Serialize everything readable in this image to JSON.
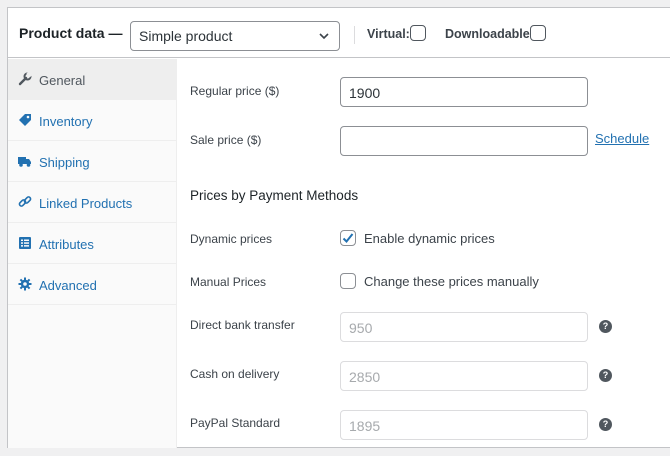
{
  "header": {
    "title": "Product data —",
    "product_type": "Simple product",
    "virtual_label": "Virtual:",
    "downloadable_label": "Downloadable:"
  },
  "tabs": [
    {
      "label": "General",
      "icon": "wrench-icon",
      "active": true
    },
    {
      "label": "Inventory",
      "icon": "tag-icon"
    },
    {
      "label": "Shipping",
      "icon": "truck-icon"
    },
    {
      "label": "Linked Products",
      "icon": "link-icon"
    },
    {
      "label": "Attributes",
      "icon": "list-icon"
    },
    {
      "label": "Advanced",
      "icon": "gear-icon"
    }
  ],
  "general": {
    "regular_price_label": "Regular price ($)",
    "regular_price_value": "1900",
    "sale_price_label": "Sale price ($)",
    "sale_price_value": "",
    "schedule_link": "Schedule",
    "section_title": "Prices by Payment Methods",
    "dynamic_prices_label": "Dynamic prices",
    "dynamic_prices_checkbox": "Enable dynamic prices",
    "dynamic_prices_checked": true,
    "manual_prices_label": "Manual Prices",
    "manual_prices_checkbox": "Change these prices manually",
    "manual_prices_checked": false,
    "payment_methods": [
      {
        "label": "Direct bank transfer",
        "value": "950"
      },
      {
        "label": "Cash on delivery",
        "value": "2850"
      },
      {
        "label": "PayPal Standard",
        "value": "1895"
      }
    ],
    "help_symbol": "?"
  },
  "colors": {
    "link": "#2271b1",
    "border": "#c3c4c7",
    "check": "#2271b1"
  }
}
